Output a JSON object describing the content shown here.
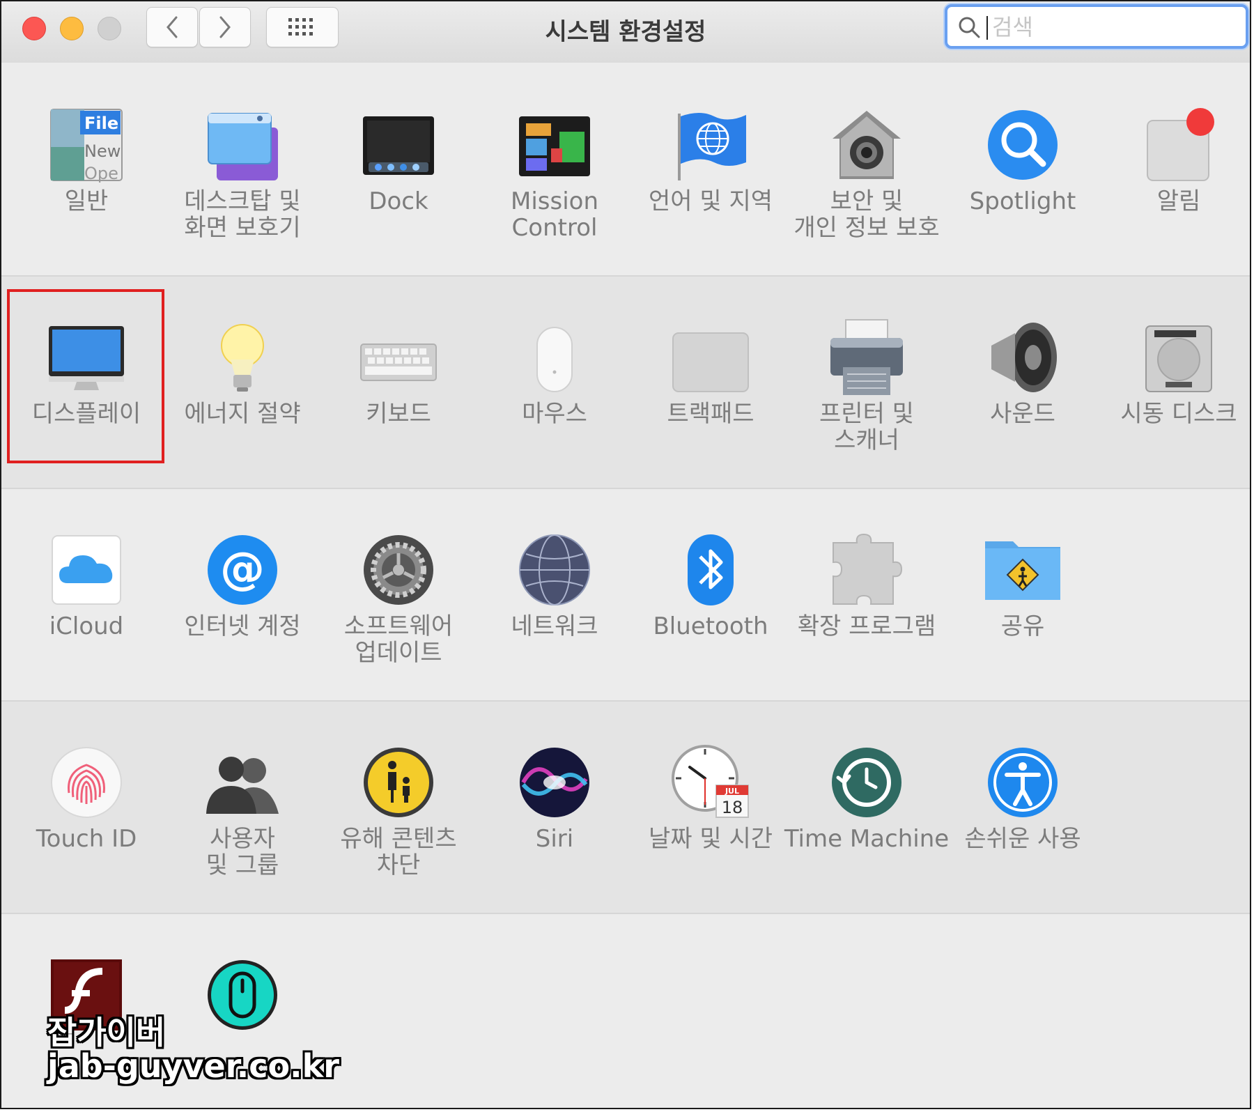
{
  "window": {
    "title": "시스템 환경설정",
    "search_placeholder": "검색"
  },
  "rows": [
    [
      {
        "label": "일반",
        "icon": "general-icon"
      },
      {
        "label": "데스크탑 및\n화면 보호기",
        "icon": "desktop-screensaver-icon"
      },
      {
        "label": "Dock",
        "icon": "dock-icon"
      },
      {
        "label": "Mission\nControl",
        "icon": "mission-control-icon"
      },
      {
        "label": "언어 및 지역",
        "icon": "language-region-flag-icon"
      },
      {
        "label": "보안 및\n개인 정보 보호",
        "icon": "security-privacy-house-icon"
      },
      {
        "label": "Spotlight",
        "icon": "spotlight-magnifier-icon"
      },
      {
        "label": "알림",
        "icon": "notifications-icon"
      }
    ],
    [
      {
        "label": "디스플레이",
        "icon": "display-monitor-icon"
      },
      {
        "label": "에너지 절약",
        "icon": "energy-saver-bulb-icon"
      },
      {
        "label": "키보드",
        "icon": "keyboard-icon"
      },
      {
        "label": "마우스",
        "icon": "mouse-icon"
      },
      {
        "label": "트랙패드",
        "icon": "trackpad-icon"
      },
      {
        "label": "프린터 및\n스캐너",
        "icon": "printer-scanner-icon"
      },
      {
        "label": "사운드",
        "icon": "sound-speaker-icon"
      },
      {
        "label": "시동 디스크",
        "icon": "startup-disk-icon"
      }
    ],
    [
      {
        "label": "iCloud",
        "icon": "icloud-icon"
      },
      {
        "label": "인터넷 계정",
        "icon": "internet-accounts-at-icon"
      },
      {
        "label": "소프트웨어\n업데이트",
        "icon": "software-update-gear-icon"
      },
      {
        "label": "네트워크",
        "icon": "network-globe-icon"
      },
      {
        "label": "Bluetooth",
        "icon": "bluetooth-icon"
      },
      {
        "label": "확장 프로그램",
        "icon": "extensions-puzzle-icon"
      },
      {
        "label": "공유",
        "icon": "sharing-folder-icon"
      }
    ],
    [
      {
        "label": "Touch ID",
        "icon": "touch-id-fingerprint-icon"
      },
      {
        "label": "사용자\n및 그룹",
        "icon": "users-groups-icon"
      },
      {
        "label": "유해 콘텐츠\n차단",
        "icon": "parental-controls-icon"
      },
      {
        "label": "Siri",
        "icon": "siri-icon"
      },
      {
        "label": "날짜 및 시간",
        "icon": "date-time-clock-icon"
      },
      {
        "label": "Time Machine",
        "icon": "time-machine-icon"
      },
      {
        "label": "손쉬운 사용",
        "icon": "accessibility-icon"
      }
    ],
    [
      {
        "label": "",
        "icon": "flash-player-icon"
      },
      {
        "label": "",
        "icon": "logitech-options-mouse-icon"
      }
    ]
  ],
  "icon_text": {
    "general": [
      "File",
      "New",
      "Ope"
    ],
    "calendar_month": "JUL",
    "calendar_day": "18"
  },
  "selected_item": "디스플레이",
  "watermark": {
    "line1": "잡가이버",
    "line2": "jab-guyver.co.kr"
  },
  "colors": {
    "highlight_border": "#e02020",
    "search_focus": "#6aa0f0",
    "close": "#fc5753",
    "minimize": "#fdbc40",
    "label_text": "#7c7c7c"
  }
}
